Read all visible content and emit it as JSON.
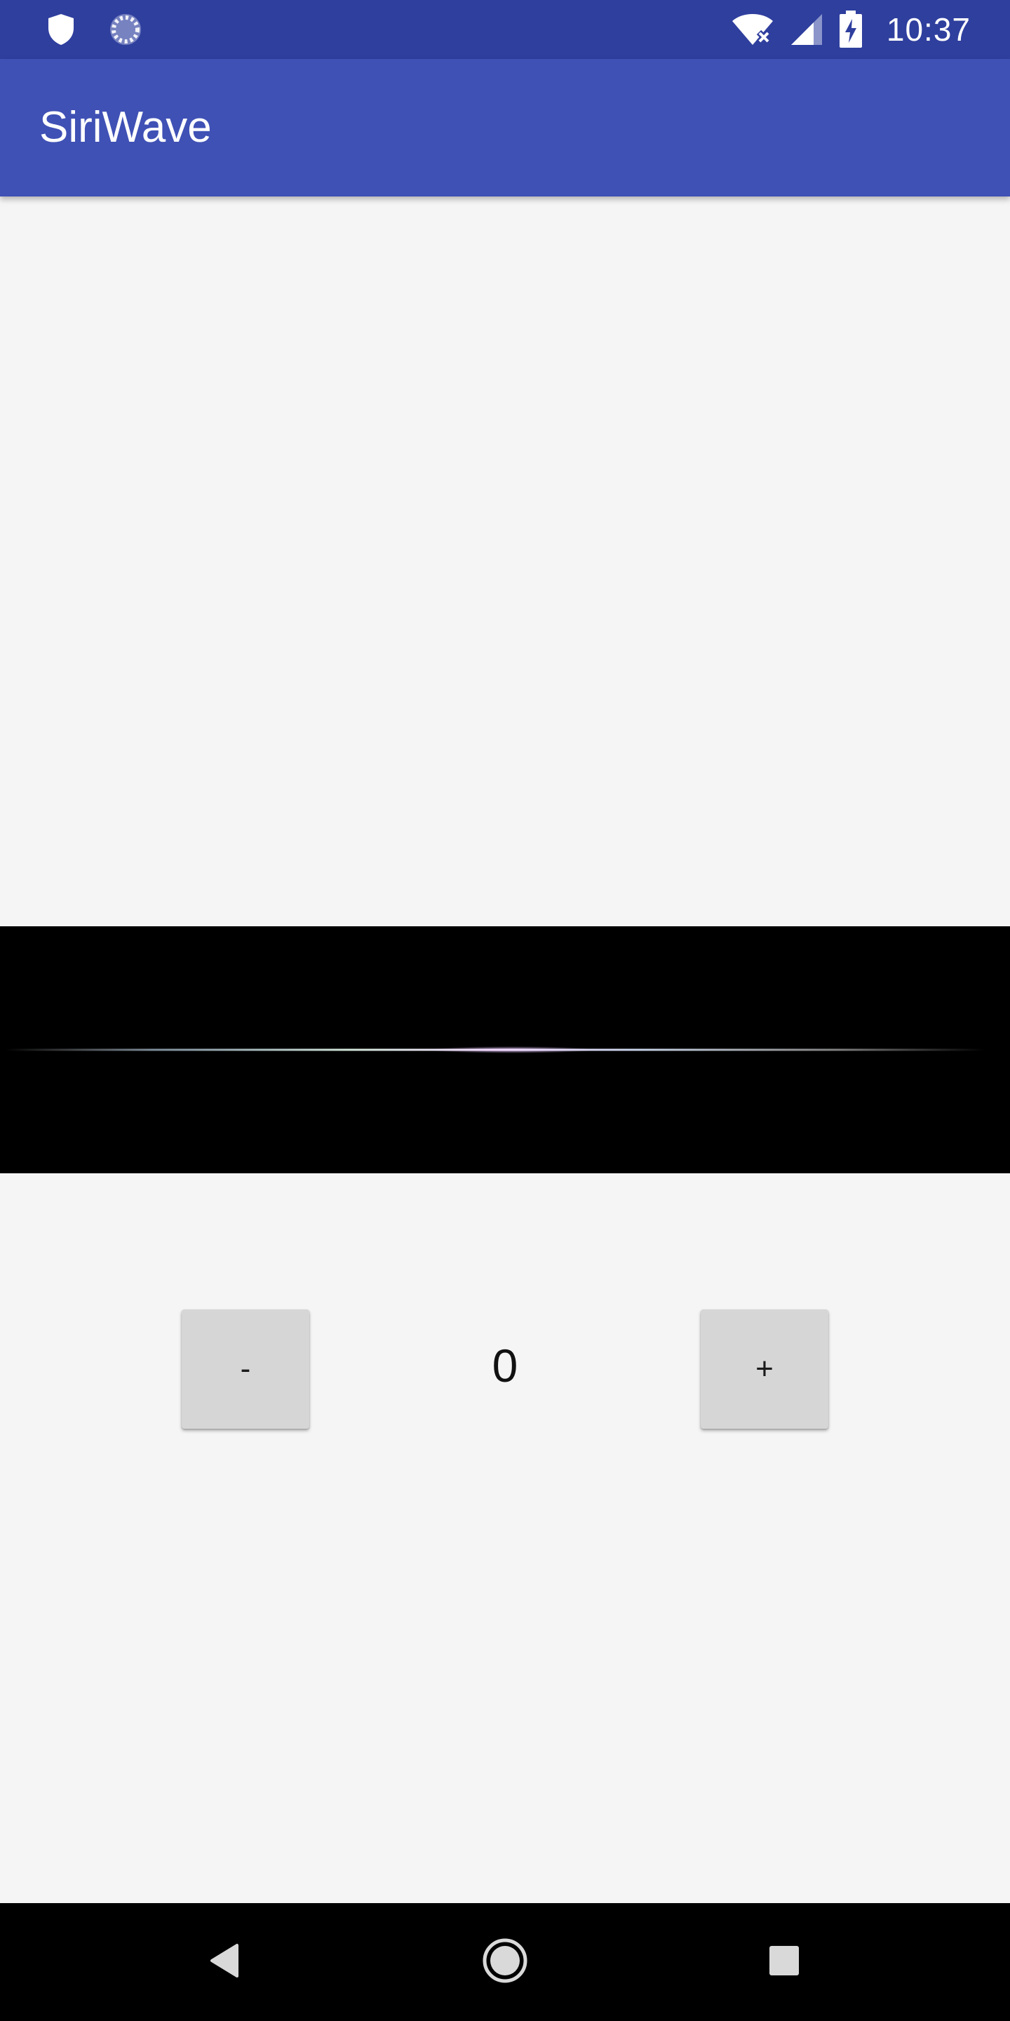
{
  "status_bar": {
    "time": "10:37",
    "icons": [
      "shield-icon",
      "loading-icon",
      "wifi-off-icon",
      "signal-icon",
      "battery-charging-icon"
    ]
  },
  "app_bar": {
    "title": "SiriWave",
    "color": "#3f51b5",
    "status_color": "#2f3f9e"
  },
  "wave": {
    "background": "#000000",
    "amplitude": 0
  },
  "controls": {
    "decrement_label": "-",
    "value": "0",
    "increment_label": "+"
  },
  "nav_bar": {
    "icons": [
      "back-icon",
      "home-icon",
      "recents-icon"
    ]
  }
}
